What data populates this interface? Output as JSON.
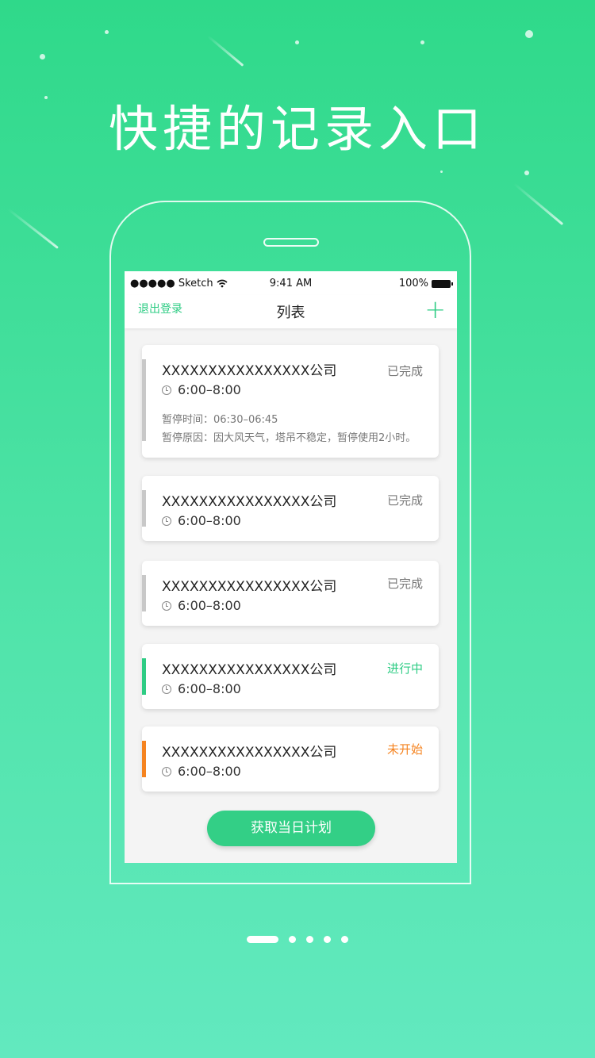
{
  "headline": "快捷的记录入口",
  "colors": {
    "accent": "#2ecc84",
    "done": "#c8c8c8",
    "in_progress": "#2ecc84",
    "not_started": "#f5831f"
  },
  "statusbar": {
    "carrier": "●●●●● Sketch",
    "time": "9:41 AM",
    "battery": "100%"
  },
  "navbar": {
    "logout_label": "退出登录",
    "title": "列表",
    "add_label": "+"
  },
  "items": [
    {
      "company": "XXXXXXXXXXXXXXXX公司",
      "time": "6:00–8:00",
      "status": "已完成",
      "pause_time": "暂停时间：06:30–06:45",
      "pause_reason": "暂停原因：因大风天气，塔吊不稳定，暂停使用2小时。"
    },
    {
      "company": "XXXXXXXXXXXXXXXX公司",
      "time": "6:00–8:00",
      "status": "已完成"
    },
    {
      "company": "XXXXXXXXXXXXXXXX公司",
      "time": "6:00–8:00",
      "status": "已完成"
    },
    {
      "company": "XXXXXXXXXXXXXXXX公司",
      "time": "6:00–8:00",
      "status": "进行中"
    },
    {
      "company": "XXXXXXXXXXXXXXXX公司",
      "time": "6:00–8:00",
      "status": "未开始"
    }
  ],
  "plan_button_label": "获取当日计划",
  "pager": {
    "total": 5,
    "active": 1
  }
}
